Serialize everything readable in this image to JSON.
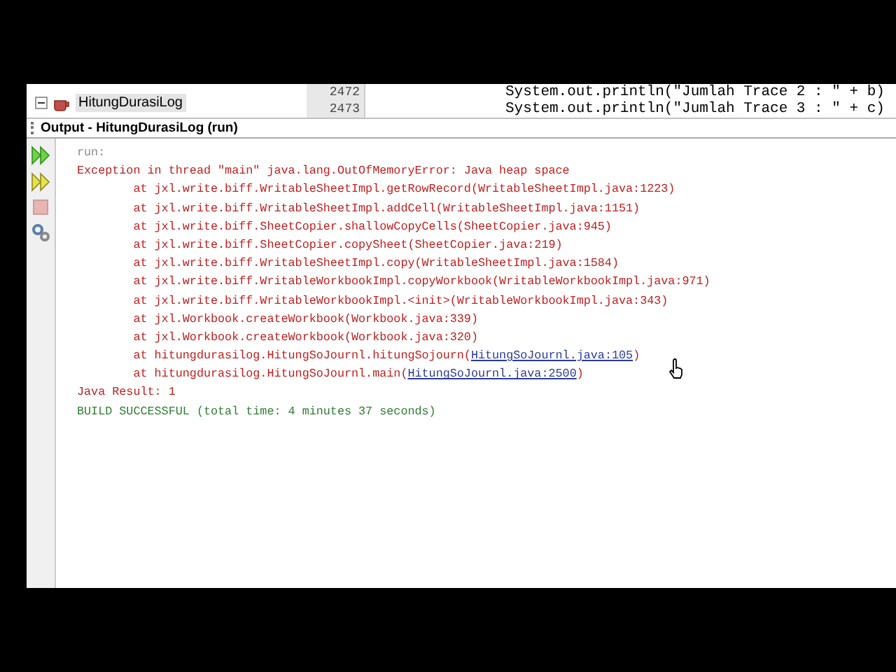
{
  "project_tree": {
    "items": [
      {
        "label": "HitungDurasiLog",
        "expanded": true,
        "selected": true
      }
    ]
  },
  "editor": {
    "lines": [
      {
        "number": "2472",
        "code": "System.out.println(\"Jumlah Trace 2 : \" + b)"
      },
      {
        "number": "2473",
        "code": "System.out.println(\"Jumlah Trace 3 : \" + c)"
      }
    ]
  },
  "output": {
    "title": "Output - HitungDurasiLog (run)",
    "lines": [
      {
        "kind": "plain",
        "text": "run:"
      },
      {
        "kind": "error",
        "text": "Exception in thread \"main\" java.lang.OutOfMemoryError: Java heap space"
      },
      {
        "kind": "error",
        "text": "        at jxl.write.biff.WritableSheetImpl.getRowRecord(WritableSheetImpl.java:1223)"
      },
      {
        "kind": "error",
        "text": "        at jxl.write.biff.WritableSheetImpl.addCell(WritableSheetImpl.java:1151)"
      },
      {
        "kind": "error",
        "text": "        at jxl.write.biff.SheetCopier.shallowCopyCells(SheetCopier.java:945)"
      },
      {
        "kind": "error",
        "text": "        at jxl.write.biff.SheetCopier.copySheet(SheetCopier.java:219)"
      },
      {
        "kind": "error",
        "text": "        at jxl.write.biff.WritableSheetImpl.copy(WritableSheetImpl.java:1584)"
      },
      {
        "kind": "error",
        "text": "        at jxl.write.biff.WritableWorkbookImpl.copyWorkbook(WritableWorkbookImpl.java:971)"
      },
      {
        "kind": "error",
        "text": "        at jxl.write.biff.WritableWorkbookImpl.<init>(WritableWorkbookImpl.java:343)"
      },
      {
        "kind": "error",
        "text": "        at jxl.Workbook.createWorkbook(Workbook.java:339)"
      },
      {
        "kind": "error",
        "text": "        at jxl.Workbook.createWorkbook(Workbook.java:320)"
      },
      {
        "kind": "link",
        "text": "        at hitungdurasilog.HitungSoJournl.hitungSojourn(",
        "link": "HitungSoJournl.java:105",
        "after": ")"
      },
      {
        "kind": "link",
        "text": "        at hitungdurasilog.HitungSoJournl.main(",
        "link": "HitungSoJournl.java:2500",
        "after": ")"
      },
      {
        "kind": "error",
        "text": "Java Result: 1"
      },
      {
        "kind": "success",
        "text": "BUILD SUCCESSFUL (total time: 4 minutes 37 seconds)"
      }
    ]
  }
}
